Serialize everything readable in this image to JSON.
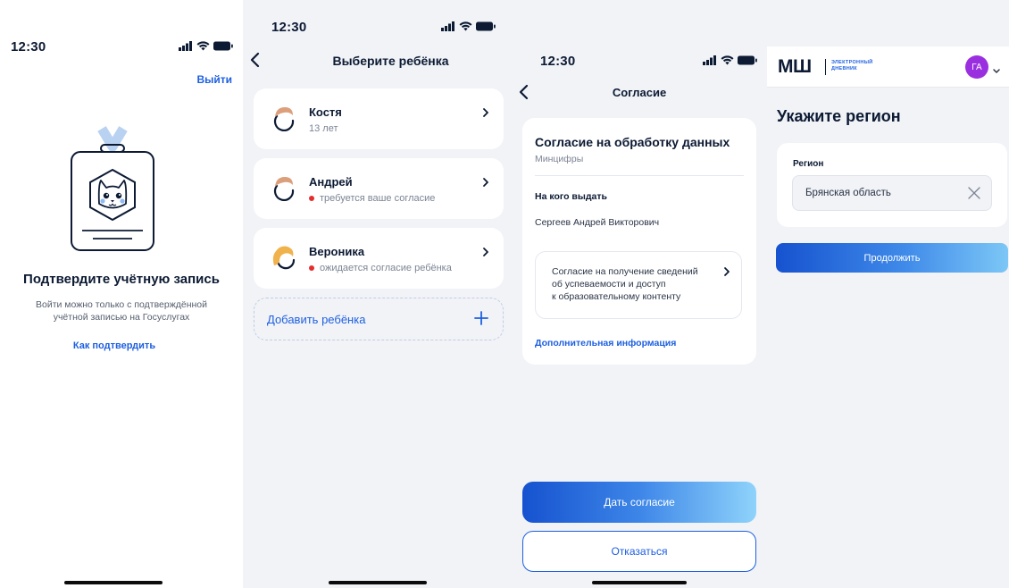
{
  "status_bar": {
    "time": "12:30"
  },
  "screen_confirm": {
    "logout_label": "Выйти",
    "title": "Подтвердите учётную запись",
    "subtitle_line1": "Войти можно только с подтверждённой",
    "subtitle_line2": "учётной записью на Госуслугах",
    "howto_link": "Как подтвердить"
  },
  "screen_children": {
    "header": "Выберите ребёнка",
    "children": [
      {
        "name": "Костя",
        "status": "13 лет",
        "alert": false
      },
      {
        "name": "Андрей",
        "status": "требуется ваше согласие",
        "alert": true
      },
      {
        "name": "Вероника",
        "status": "ожидается согласие ребёнка",
        "alert": true
      }
    ],
    "add_child_label": "Добавить ребёнка"
  },
  "screen_consent": {
    "header": "Согласие",
    "card_title": "Согласие на обработку данных",
    "card_subtitle": "Минцифры",
    "recipient_label": "На кого выдать",
    "recipient_name": "Сергеев Андрей Викторович",
    "consent_item_line1": "Согласие на получение сведений",
    "consent_item_line2": "об успеваемости и доступ",
    "consent_item_line3": "к образовательному контенту",
    "more_info_link": "Дополнительная информация",
    "agree_button": "Дать согласие",
    "decline_button": "Отказаться"
  },
  "screen_region": {
    "logo_text": "МШ",
    "logo_sub_line1": "ЭЛЕКТРОННЫЙ",
    "logo_sub_line2": "ДНЕВНИК",
    "user_initials": "ГА",
    "title": "Укажите регион",
    "field_label": "Регион",
    "field_value": "Брянская область",
    "continue_button": "Продолжить"
  },
  "colors": {
    "accent": "#1d5fe0",
    "alert_dot": "#e52d2d",
    "avatar_bg": "#9a2fe0",
    "screen_bg": "#f1f3f7"
  },
  "icons": [
    "signal-icon",
    "wifi-icon",
    "battery-icon",
    "back-arrow-icon",
    "chevron-right-icon",
    "plus-icon",
    "clear-icon",
    "chevron-down-icon",
    "child-avatar-icon",
    "account-badge-illustration"
  ]
}
